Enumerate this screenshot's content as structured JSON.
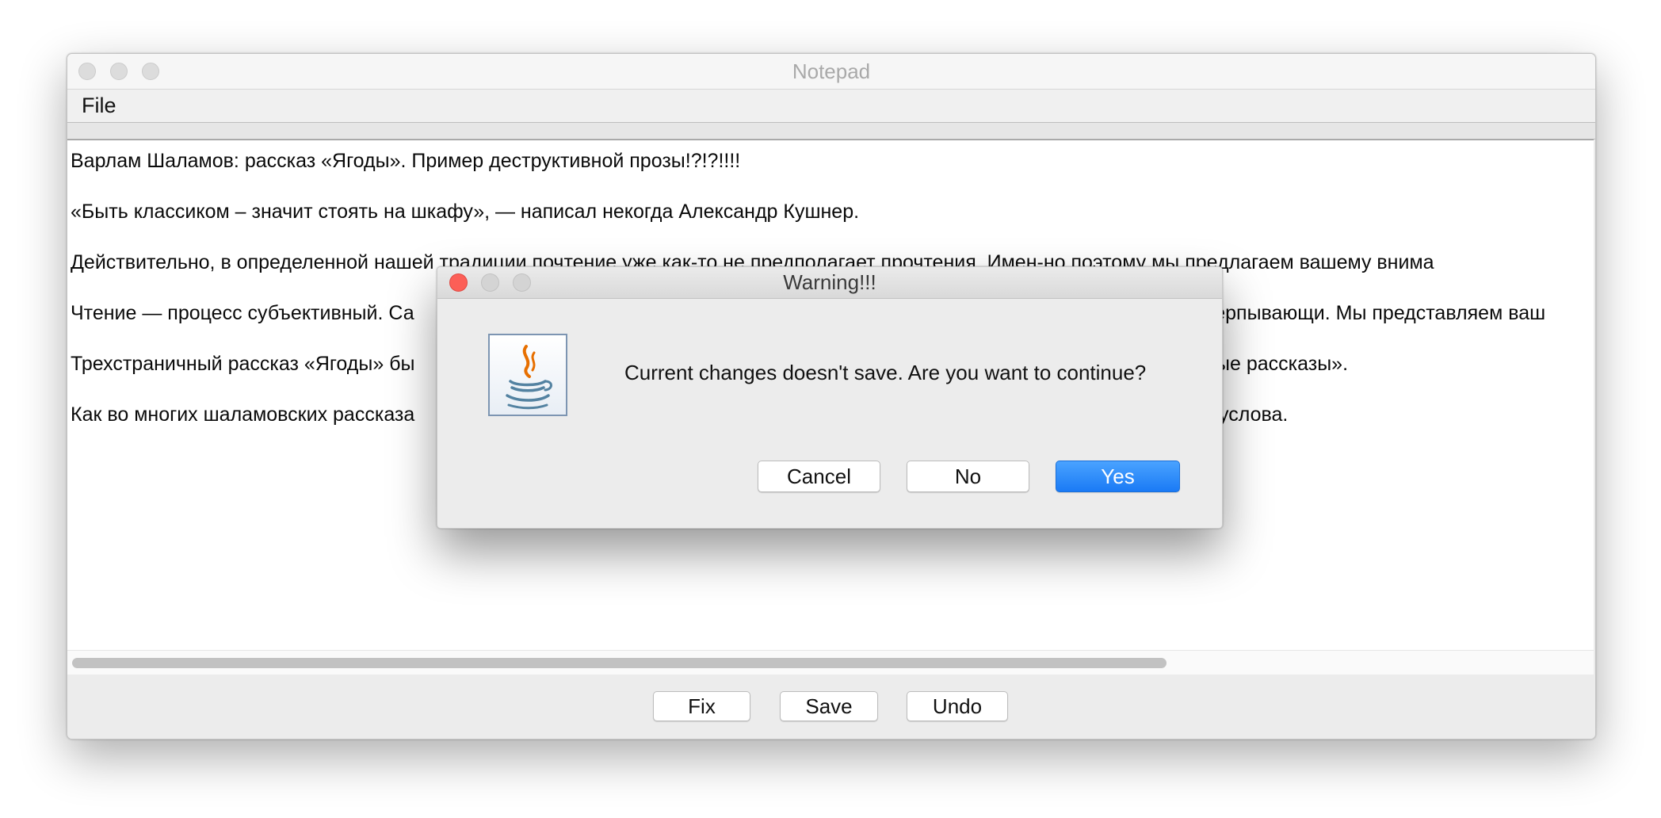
{
  "window": {
    "title": "Notepad"
  },
  "menu": {
    "file_label": "File"
  },
  "editor": {
    "lines": [
      "Варлам Шаламов: рассказ «Ягоды». Пример деструктивной прозы!?!?!!!!",
      "«Быть классиком – значит стоять на шкафу», — написал некогда Александр Кушнер.",
      "Действительно, в определенной нашей традиции почтение уже как-то не предполагает прочтения. Имен-но поэтому мы предлагаем вашему внима",
      "Чтение — процесс субъективный. Са",
      "Трехстраничный рассказ «Ягоды» бы",
      "Как во многих шаламовских рассказа"
    ],
    "lines_right": {
      "line4": "счерпывающи. Мы представляем ваш",
      "line5": "ые рассказы».",
      "line6": "услова."
    }
  },
  "toolbar": {
    "fix_label": "Fix",
    "save_label": "Save",
    "undo_label": "Undo"
  },
  "dialog": {
    "title": "Warning!!!",
    "message": "Current changes doesn't save. Are you want to continue?",
    "cancel_label": "Cancel",
    "no_label": "No",
    "yes_label": "Yes",
    "icon": "java-icon"
  },
  "colors": {
    "default_button": "#1a7af5",
    "close_button": "#fc5f57"
  }
}
